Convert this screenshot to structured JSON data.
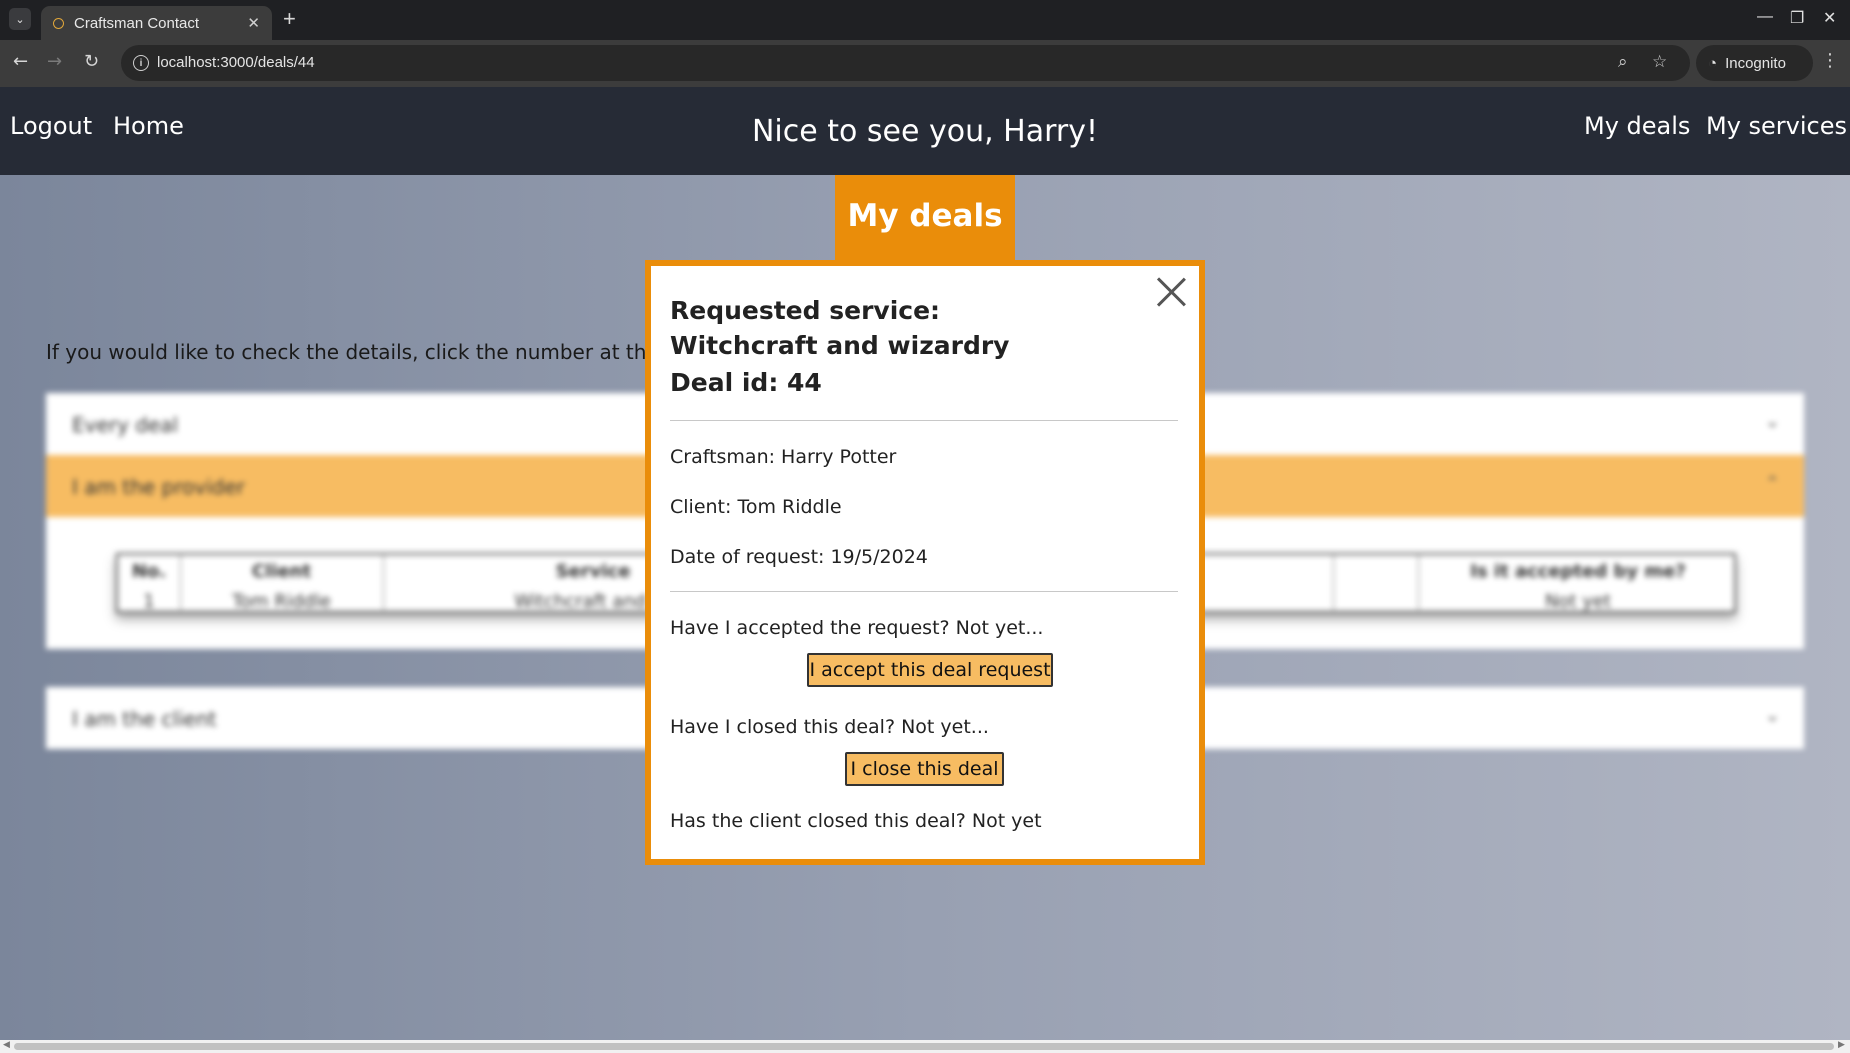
{
  "browser": {
    "tab_title": "Craftsman Contact",
    "url": "localhost:3000/deals/44",
    "incognito_label": "Incognito"
  },
  "header": {
    "logout": "Logout",
    "home": "Home",
    "greeting": "Nice to see you, Harry!",
    "my_deals": "My deals",
    "my_services": "My services"
  },
  "page": {
    "title": "My deals",
    "instructions": "If you would like to check the details, click the number at the begir",
    "accordion": [
      {
        "label": "Every deal"
      },
      {
        "label": "I am the provider"
      },
      {
        "label": "I am the client"
      }
    ],
    "table": {
      "headers": [
        "No.",
        "Client",
        "Service",
        "",
        "Is it accepted by me?"
      ],
      "row": [
        "1",
        "Tom Riddle",
        "Witchcraft and wi",
        "",
        "Not yet"
      ]
    }
  },
  "modal": {
    "heading_line1": "Requested service:",
    "heading_line2": "Witchcraft and wizardry",
    "heading_line3": "Deal id: 44",
    "craftsman": "Craftsman: Harry Potter",
    "client": "Client: Tom Riddle",
    "date": "Date of request: 19/5/2024",
    "accepted_q": "Have I accepted the request? Not yet...",
    "accept_button": "I accept this deal request",
    "closed_q": "Have I closed this deal? Not yet...",
    "close_button": "I close this deal",
    "client_closed_q": "Has the client closed this deal? Not yet"
  },
  "colors": {
    "accent_orange": "#ea8d0a",
    "button_fill": "#f7bc62",
    "header_bg": "#262b36"
  }
}
